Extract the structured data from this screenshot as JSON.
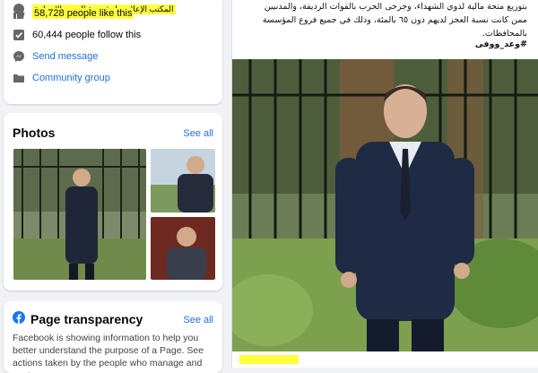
{
  "about": {
    "partial_line": "المكتب الإعلامي لمؤسسة العرين الإنسانية",
    "likes": "58,728 people like this",
    "follows": "60,444 people follow this",
    "send_message": "Send message",
    "community_group": "Community group"
  },
  "photos": {
    "title": "Photos",
    "see_all": "See all"
  },
  "transparency": {
    "title": "Page transparency",
    "see_all": "See all",
    "text": "Facebook is showing information to help you better understand the purpose of a Page. See actions taken by the people who manage and post"
  },
  "post": {
    "text_line1": "بتوزيع منحة مالية لذوي الشهداء، وجرحى الحرب بالقوات الرديفة، والمدنيين",
    "text_line2": "ممن كانت نسبة العجز لديهم دون ٦٥ بالمئة، وذلك في جميع فروع المؤسسة",
    "text_line3": "بالمحافظات.",
    "hashtag": "#وعد_ووفى"
  },
  "colors": {
    "link": "#216fdb",
    "highlight": "#ffff40",
    "background": "#f0f2f5"
  }
}
